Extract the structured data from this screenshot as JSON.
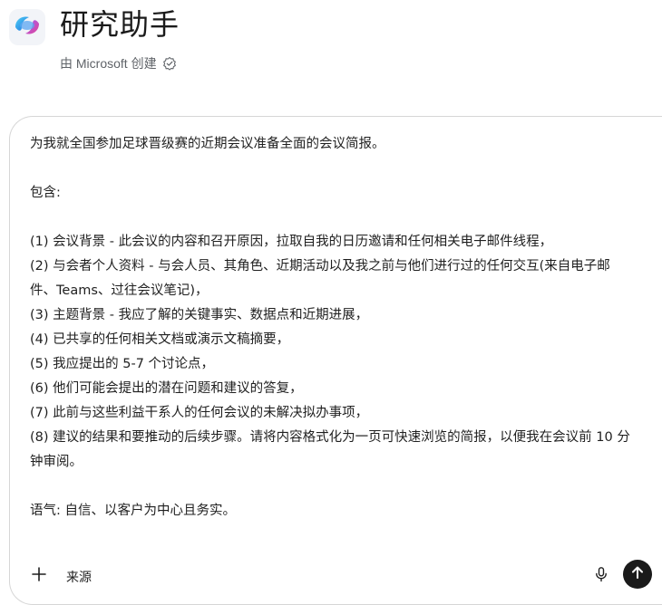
{
  "app": {
    "title": "研究助手",
    "byline": "由 Microsoft 创建",
    "logo_icon": "copilot-logo-icon",
    "verified_icon": "verified-badge-icon"
  },
  "composer": {
    "prompt": "为我就全国参加足球晋级赛的近期会议准备全面的会议简报。\n\n包含:\n\n(1) 会议背景 - 此会议的内容和召开原因，拉取自我的日历邀请和任何相关电子邮件线程，\n(2) 与会者个人资料 - 与会人员、其角色、近期活动以及我之前与他们进行过的任何交互(来自电子邮件、Teams、过往会议笔记)，\n(3) 主题背景 - 我应了解的关键事实、数据点和近期进展，\n(4) 已共享的任何相关文档或演示文稿摘要，\n(5) 我应提出的 5-7 个讨论点，\n(6) 他们可能会提出的潜在问题和建议的答复，\n(7) 此前与这些利益干系人的任何会议的未解决拟办事项，\n(8) 建议的结果和要推动的后续步骤。请将内容格式化为一页可快速浏览的简报，以便我在会议前 10 分钟审阅。\n\n语气: 自信、以客户为中心且务实。",
    "sources_label": "来源",
    "add_icon": "plus-icon",
    "mic_icon": "microphone-icon",
    "send_icon": "arrow-up-icon"
  },
  "colors": {
    "send_button": "#1a1a1a",
    "border": "#d6d6d6",
    "secondary_text": "#5f6368"
  }
}
